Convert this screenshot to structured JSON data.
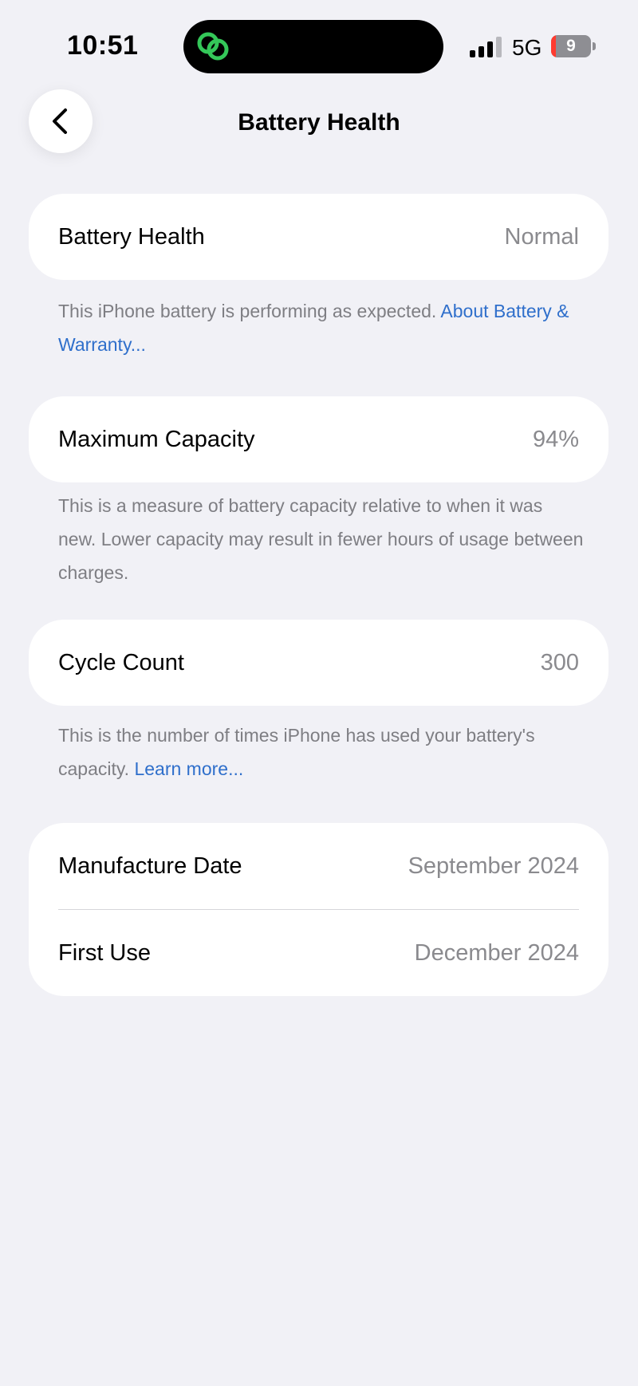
{
  "status_bar": {
    "time": "10:51",
    "network": "5G",
    "battery_level": "9",
    "battery_percent": 9,
    "island_icon": "linked-circles-icon",
    "island_icon_color": "#34C759"
  },
  "nav": {
    "back_icon": "chevron-left-icon",
    "title": "Battery Health"
  },
  "battery_health": {
    "label": "Battery Health",
    "value": "Normal",
    "note": "This iPhone battery is performing as expected.",
    "note_link": "About Battery & Warranty..."
  },
  "maximum_capacity": {
    "label": "Maximum Capacity",
    "value": "94%",
    "note": "This is a measure of battery capacity relative to when it was new. Lower capacity may result in fewer hours of usage between charges."
  },
  "cycle_count": {
    "label": "Cycle Count",
    "value": "300",
    "note": "This is the number of times iPhone has used your battery's capacity.",
    "note_link": "Learn more..."
  },
  "dates": {
    "manufacture_label": "Manufacture Date",
    "manufacture_value": "September 2024",
    "first_use_label": "First Use",
    "first_use_value": "December 2024"
  },
  "colors": {
    "background": "#F1F1F6",
    "card": "#FFFFFF",
    "link": "#2F6FCB",
    "secondary_text": "#8A8A8E",
    "battery_low": "#FF3B30"
  }
}
